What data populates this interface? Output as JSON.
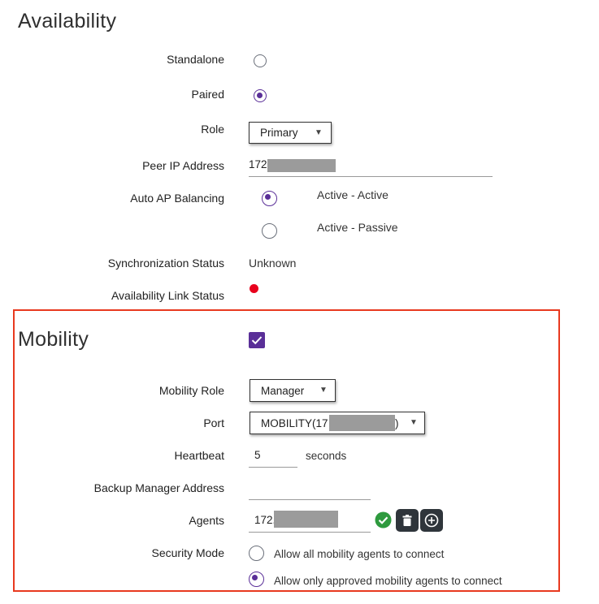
{
  "availability": {
    "title": "Availability",
    "standalone_label": "Standalone",
    "paired_label": "Paired",
    "role_label": "Role",
    "role_value": "Primary",
    "peer_ip_label": "Peer IP Address",
    "peer_ip_value": "172",
    "auto_ap_label": "Auto AP Balancing",
    "active_active_label": "Active - Active",
    "active_passive_label": "Active - Passive",
    "sync_status_label": "Synchronization Status",
    "sync_status_value": "Unknown",
    "link_status_label": "Availability Link Status",
    "link_status_color": "#e8001c"
  },
  "mobility": {
    "title": "Mobility",
    "mobility_role_label": "Mobility Role",
    "mobility_role_value": "Manager",
    "port_label": "Port",
    "port_value_prefix": "MOBILITY(17",
    "port_value_suffix": ")",
    "heartbeat_label": "Heartbeat",
    "heartbeat_value": "5",
    "heartbeat_unit": "seconds",
    "backup_label": "Backup Manager Address",
    "backup_value": "",
    "agents_label": "Agents",
    "agents_value": "172.",
    "security_label": "Security Mode",
    "security_allow_all": "Allow all mobility agents to connect",
    "security_allow_approved": "Allow only approved mobility agents to connect"
  },
  "colors": {
    "accent": "#5a2f98",
    "highlight_border": "#e8391f",
    "valid_check": "#2e9a3e",
    "icon_button_bg": "#2f353b"
  },
  "icons": {
    "caret": "caret-down-icon",
    "valid": "check-circle-icon",
    "delete": "trash-icon",
    "add": "plus-circle-icon"
  }
}
